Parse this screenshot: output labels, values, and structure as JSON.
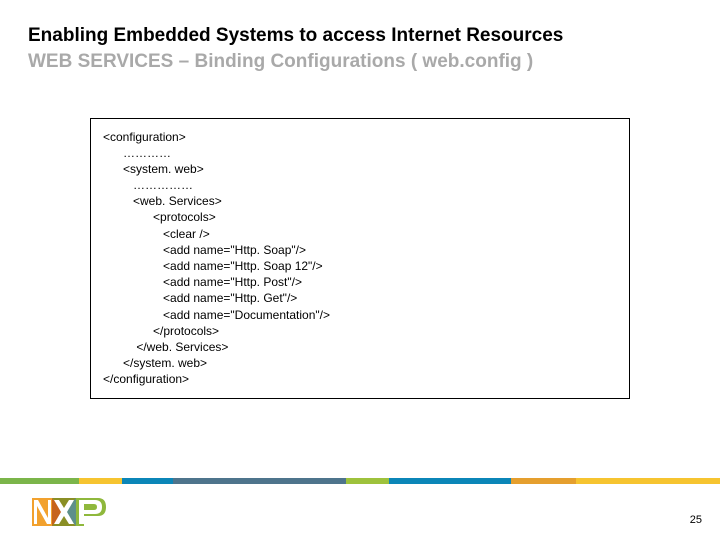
{
  "title": {
    "line1": "Enabling Embedded Systems to access Internet Resources",
    "line2": "WEB SERVICES – Binding Configurations ( web.config )"
  },
  "code": {
    "l01": "<configuration>",
    "l02": "      …………",
    "l03": "      <system. web>",
    "l04": "         ……………",
    "l05": "         <web. Services>",
    "l06": "               <protocols>",
    "l07": "                  <clear />",
    "l08": "                  <add name=\"Http. Soap\"/>",
    "l09": "                  <add name=\"Http. Soap 12\"/>",
    "l10": "                  <add name=\"Http. Post\"/>",
    "l11": "                  <add name=\"Http. Get\"/>",
    "l12": "                  <add name=\"Documentation\"/>",
    "l13": "               </protocols>",
    "l14": "          </web. Services>",
    "l15": "      </system. web>",
    "l16": "</configuration>"
  },
  "page_number": "25",
  "logo_alt": "NXP"
}
